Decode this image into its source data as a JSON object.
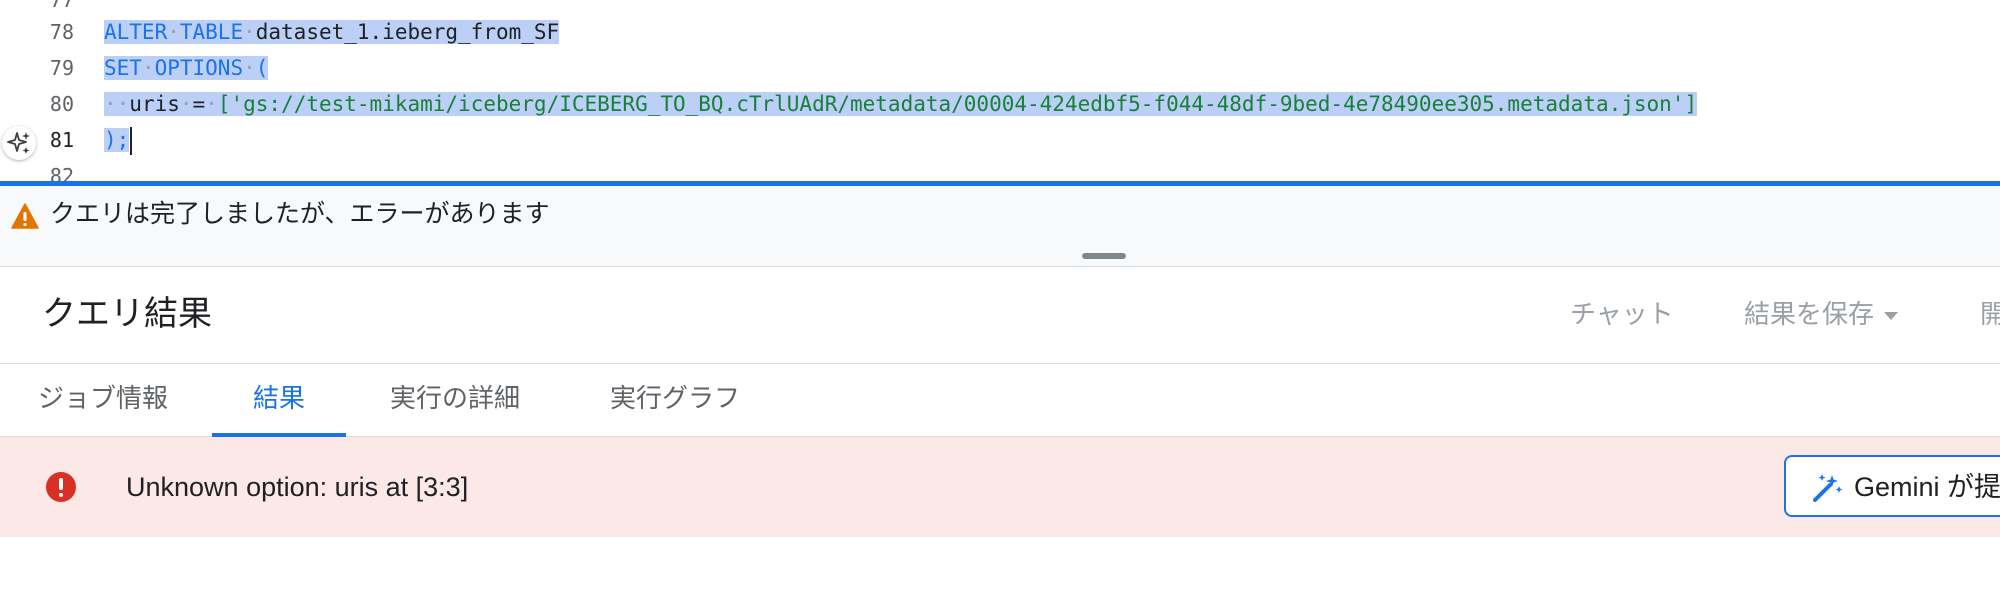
{
  "editor": {
    "line_numbers": [
      "77",
      "78",
      "79",
      "80",
      "81",
      "82"
    ],
    "lines": [
      {
        "tokens": [
          {
            "text": "ALTER",
            "cls": "kw"
          },
          {
            "text": "·",
            "cls": "ws"
          },
          {
            "text": "TABLE",
            "cls": "kw"
          },
          {
            "text": "·",
            "cls": "ws"
          },
          {
            "text": "dataset_1.ieberg_from_SF",
            "cls": "id"
          }
        ]
      },
      {
        "tokens": [
          {
            "text": "SET",
            "cls": "kw"
          },
          {
            "text": "·",
            "cls": "ws"
          },
          {
            "text": "OPTIONS",
            "cls": "kw"
          },
          {
            "text": "·",
            "cls": "ws"
          },
          {
            "text": "(",
            "cls": "kw"
          }
        ]
      },
      {
        "tokens": [
          {
            "text": "··",
            "cls": "ws"
          },
          {
            "text": "uris",
            "cls": "id"
          },
          {
            "text": "·",
            "cls": "ws"
          },
          {
            "text": "=",
            "cls": "id"
          },
          {
            "text": "·",
            "cls": "ws"
          },
          {
            "text": "['gs://test-mikami/iceberg/ICEBERG_TO_BQ.cTrlUAdR/metadata/00004-424edbf5-f044-48df-9bed-4e78490ee305.metadata.json']",
            "cls": "str"
          }
        ]
      },
      {
        "tokens": [
          {
            "text": ");",
            "cls": "kw"
          }
        ]
      }
    ]
  },
  "status": {
    "message": "クエリは完了しましたが、エラーがあります"
  },
  "results": {
    "title": "クエリ結果",
    "chat_label": "チャット",
    "save_label": "結果を保存",
    "open_label": "開"
  },
  "tabs": [
    {
      "label": "ジョブ情報"
    },
    {
      "label": "結果"
    },
    {
      "label": "実行の詳細"
    },
    {
      "label": "実行グラフ"
    }
  ],
  "error": {
    "message": "Unknown option: uris at [3:3]",
    "gemini_label": "Gemini が提"
  },
  "colors": {
    "accent": "#1a73e8",
    "selection": "#bcd0f7",
    "string": "#188038",
    "error": "#d93025",
    "warning": "#e37400",
    "error_bg": "#fce8e6"
  },
  "icons": {
    "gemini_spark": "sparkle-icon",
    "warning": "warning-triangle-icon",
    "error": "error-circle-icon",
    "gemini_button": "magic-wand-icon"
  }
}
